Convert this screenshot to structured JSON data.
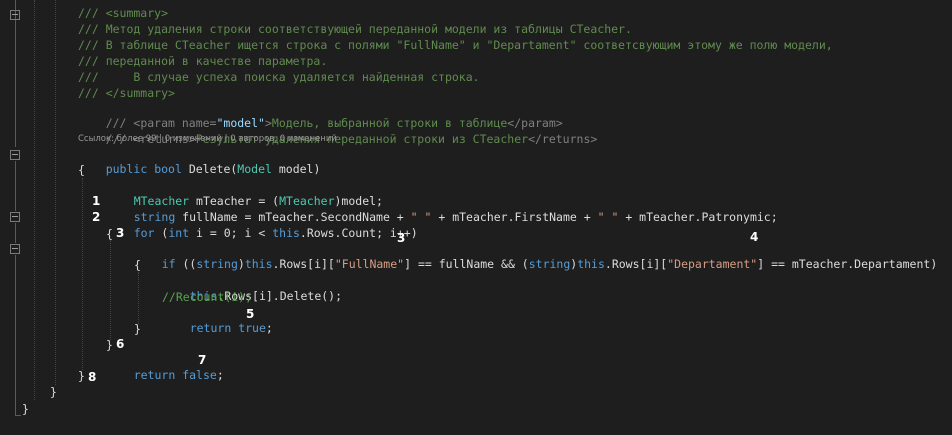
{
  "code": {
    "doc_lines": [
      "/// <summary>",
      "/// Метод удаления строки соответствующей переданной модели из таблицы CTeacher.",
      "/// В таблице CTeacher ищется строка с полями \"FullName\" и \"Departament\" соответсвующим этому же полю модели,",
      "/// переданной в качестве параметра.",
      "///     В случае успеха поиска удаляется найденная строка.",
      "/// </summary>"
    ],
    "param_tag_open": "/// <param name=",
    "param_name": "\"model\"",
    "param_tag_close": ">",
    "param_text": "Модель, выбранной строки в таблице",
    "param_end": "</param>",
    "returns_open": "/// <returns>",
    "returns_text": "Результат удаления переданной строки из CTeacher",
    "returns_close": "</returns>",
    "codelens": "Ссылок: более 99 | 0 изменений | 0 авторов, 0 изменений",
    "sig_public": "public",
    "sig_bool": "bool",
    "sig_name": "Delete(",
    "sig_type": "Model",
    "sig_rest": " model)",
    "brace_open": "{",
    "brace_close": "}",
    "l_mteacher_type": "MTeacher",
    "l_mteacher_rest": " mTeacher = (",
    "l_mteacher_cast": "MTeacher",
    "l_mteacher_end": ")model;",
    "l_string_kw": "string",
    "l_fullname_a": " fullName = mTeacher.SecondName + ",
    "l_str_space": "\" \"",
    "l_fullname_b": " + mTeacher.FirstName + ",
    "l_fullname_c": " + mTeacher.Patronymic;",
    "l_for": "for",
    "l_for_a": " (",
    "l_int": "int",
    "l_for_b": " i = 0; i < ",
    "l_this": "this",
    "l_for_c": ".Rows.Count; i++)",
    "l_if": "if",
    "l_if_a": " ((",
    "l_if_string": "string",
    "l_if_b": ")",
    "l_if_this": "this",
    "l_if_c": ".Rows[i][",
    "l_if_fullname": "\"FullName\"",
    "l_if_d": "] == fullName && (",
    "l_if_string2": "string",
    "l_if_e": ")",
    "l_if_this2": "this",
    "l_if_f": ".Rows[i][",
    "l_if_dep": "\"Departament\"",
    "l_if_g": "] == mTeacher.Departament)",
    "l_del_this": "this",
    "l_del_rest": ".Rows[i].Delete();",
    "l_recount": "//Recount(i);",
    "l_return": "return",
    "l_true": "true",
    "l_false": "false",
    "semicolon": ";"
  },
  "annotations": [
    "1",
    "2",
    "3",
    "3",
    "4",
    "5",
    "6",
    "7",
    "8"
  ]
}
